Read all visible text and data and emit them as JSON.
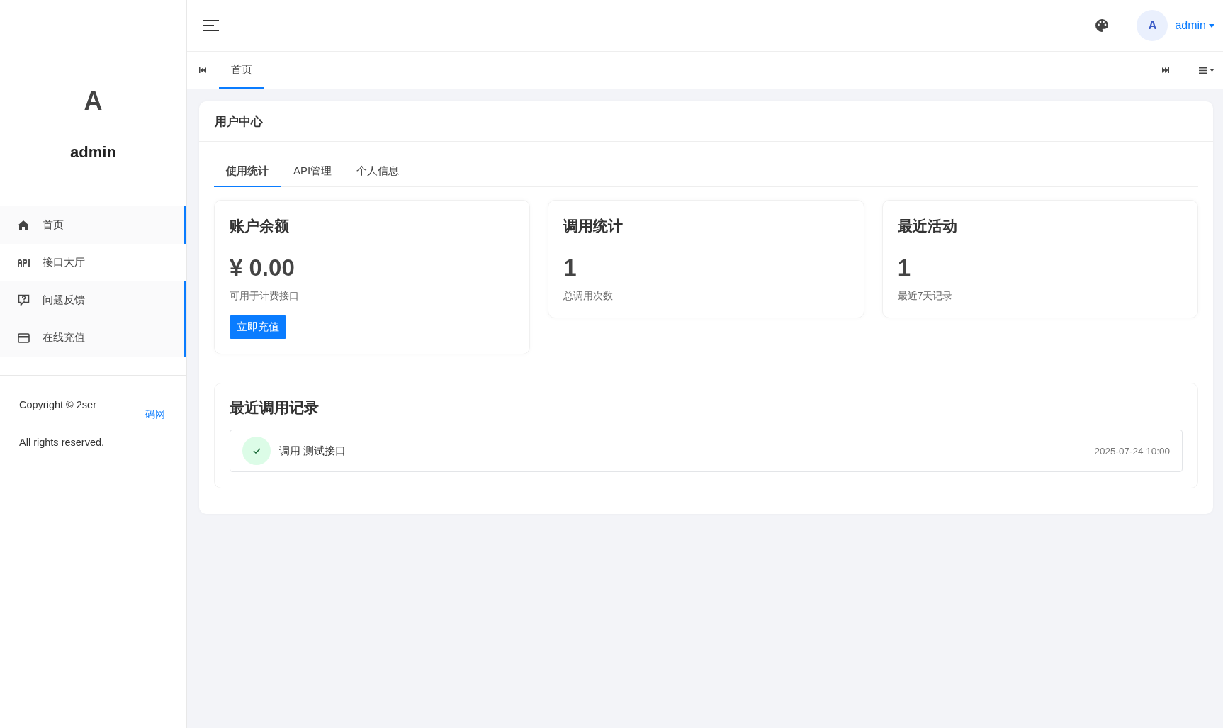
{
  "sidebar": {
    "avatar_letter": "A",
    "username": "admin",
    "menu": [
      {
        "label": "首页",
        "selected": true
      },
      {
        "label": "接口大厅",
        "selected": false
      },
      {
        "label": "问题反馈",
        "selected": true
      },
      {
        "label": "在线充值",
        "selected": true
      }
    ],
    "copyright": {
      "text": "Copyright © 2ser",
      "link": "码网",
      "line2": "All rights reserved."
    }
  },
  "topbar": {
    "avatar_letter": "A",
    "user": "admin"
  },
  "page_tabs": [
    {
      "label": "首页",
      "selected": true
    }
  ],
  "panel": {
    "title": "用户中心",
    "tabs": [
      {
        "label": "使用统计",
        "selected": true
      },
      {
        "label": "API管理",
        "selected": false
      },
      {
        "label": "个人信息",
        "selected": false
      }
    ],
    "stats": [
      {
        "title": "账户余额",
        "value": "¥ 0.00",
        "caption": "可用于计费接口",
        "button": "立即充值"
      },
      {
        "title": "调用统计",
        "value": "1",
        "caption": "总调用次数"
      },
      {
        "title": "最近活动",
        "value": "1",
        "caption": "最近7天记录"
      }
    ],
    "recent": {
      "title": "最近调用记录",
      "items": [
        {
          "success": true,
          "text": "调用 测试接口",
          "time": "2025-07-24 10:00"
        }
      ]
    }
  }
}
